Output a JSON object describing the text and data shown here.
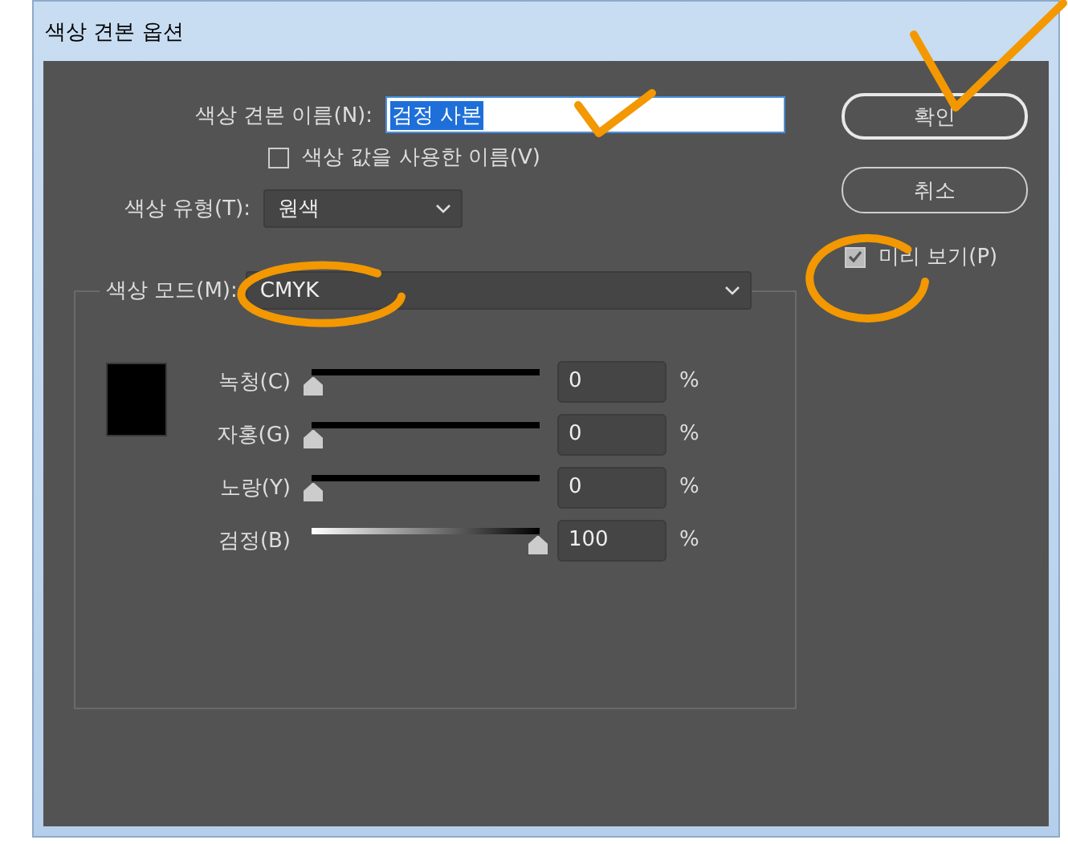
{
  "window": {
    "title": "색상 견본 옵션"
  },
  "name_field": {
    "label": "색상 견본 이름(N):",
    "value": "검정 사본",
    "text_selected": true
  },
  "use_value_name": {
    "label": "색상 값을 사용한 이름(V)",
    "checked": false
  },
  "color_type": {
    "label": "색상 유형(T):",
    "value": "원색"
  },
  "color_mode": {
    "label": "색상 모드(M):",
    "value": "CMYK"
  },
  "swatch": {
    "color": "#000000"
  },
  "channels": [
    {
      "name": "녹청(C)",
      "kind": "solid",
      "level": 0,
      "value": "0",
      "unit": "%"
    },
    {
      "name": "자홍(G)",
      "kind": "solid",
      "level": 0,
      "value": "0",
      "unit": "%"
    },
    {
      "name": "노랑(Y)",
      "kind": "solid",
      "level": 0,
      "value": "0",
      "unit": "%"
    },
    {
      "name": "검정(B)",
      "kind": "gradient",
      "level": 1,
      "value": "100",
      "unit": "%"
    }
  ],
  "buttons": [
    {
      "label": "확인",
      "default": true
    },
    {
      "label": "취소",
      "default": false
    }
  ],
  "preview": {
    "label": "미리 보기(P)",
    "checked": true
  },
  "annotations": [
    {
      "kind": "check"
    },
    {
      "kind": "check"
    },
    {
      "kind": "circle"
    },
    {
      "kind": "circle"
    }
  ]
}
